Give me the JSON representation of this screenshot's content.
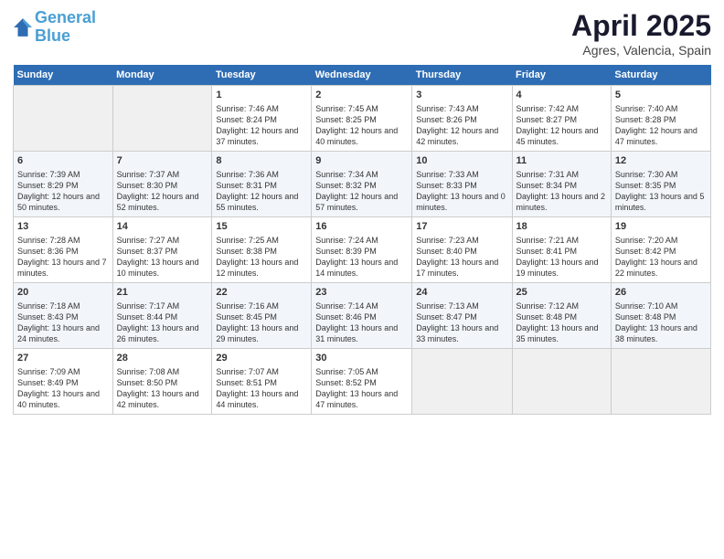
{
  "header": {
    "logo_line1": "General",
    "logo_line2": "Blue",
    "title": "April 2025",
    "subtitle": "Agres, Valencia, Spain"
  },
  "columns": [
    "Sunday",
    "Monday",
    "Tuesday",
    "Wednesday",
    "Thursday",
    "Friday",
    "Saturday"
  ],
  "weeks": [
    [
      {
        "day": "",
        "info": ""
      },
      {
        "day": "",
        "info": ""
      },
      {
        "day": "1",
        "info": "Sunrise: 7:46 AM\nSunset: 8:24 PM\nDaylight: 12 hours and 37 minutes."
      },
      {
        "day": "2",
        "info": "Sunrise: 7:45 AM\nSunset: 8:25 PM\nDaylight: 12 hours and 40 minutes."
      },
      {
        "day": "3",
        "info": "Sunrise: 7:43 AM\nSunset: 8:26 PM\nDaylight: 12 hours and 42 minutes."
      },
      {
        "day": "4",
        "info": "Sunrise: 7:42 AM\nSunset: 8:27 PM\nDaylight: 12 hours and 45 minutes."
      },
      {
        "day": "5",
        "info": "Sunrise: 7:40 AM\nSunset: 8:28 PM\nDaylight: 12 hours and 47 minutes."
      }
    ],
    [
      {
        "day": "6",
        "info": "Sunrise: 7:39 AM\nSunset: 8:29 PM\nDaylight: 12 hours and 50 minutes."
      },
      {
        "day": "7",
        "info": "Sunrise: 7:37 AM\nSunset: 8:30 PM\nDaylight: 12 hours and 52 minutes."
      },
      {
        "day": "8",
        "info": "Sunrise: 7:36 AM\nSunset: 8:31 PM\nDaylight: 12 hours and 55 minutes."
      },
      {
        "day": "9",
        "info": "Sunrise: 7:34 AM\nSunset: 8:32 PM\nDaylight: 12 hours and 57 minutes."
      },
      {
        "day": "10",
        "info": "Sunrise: 7:33 AM\nSunset: 8:33 PM\nDaylight: 13 hours and 0 minutes."
      },
      {
        "day": "11",
        "info": "Sunrise: 7:31 AM\nSunset: 8:34 PM\nDaylight: 13 hours and 2 minutes."
      },
      {
        "day": "12",
        "info": "Sunrise: 7:30 AM\nSunset: 8:35 PM\nDaylight: 13 hours and 5 minutes."
      }
    ],
    [
      {
        "day": "13",
        "info": "Sunrise: 7:28 AM\nSunset: 8:36 PM\nDaylight: 13 hours and 7 minutes."
      },
      {
        "day": "14",
        "info": "Sunrise: 7:27 AM\nSunset: 8:37 PM\nDaylight: 13 hours and 10 minutes."
      },
      {
        "day": "15",
        "info": "Sunrise: 7:25 AM\nSunset: 8:38 PM\nDaylight: 13 hours and 12 minutes."
      },
      {
        "day": "16",
        "info": "Sunrise: 7:24 AM\nSunset: 8:39 PM\nDaylight: 13 hours and 14 minutes."
      },
      {
        "day": "17",
        "info": "Sunrise: 7:23 AM\nSunset: 8:40 PM\nDaylight: 13 hours and 17 minutes."
      },
      {
        "day": "18",
        "info": "Sunrise: 7:21 AM\nSunset: 8:41 PM\nDaylight: 13 hours and 19 minutes."
      },
      {
        "day": "19",
        "info": "Sunrise: 7:20 AM\nSunset: 8:42 PM\nDaylight: 13 hours and 22 minutes."
      }
    ],
    [
      {
        "day": "20",
        "info": "Sunrise: 7:18 AM\nSunset: 8:43 PM\nDaylight: 13 hours and 24 minutes."
      },
      {
        "day": "21",
        "info": "Sunrise: 7:17 AM\nSunset: 8:44 PM\nDaylight: 13 hours and 26 minutes."
      },
      {
        "day": "22",
        "info": "Sunrise: 7:16 AM\nSunset: 8:45 PM\nDaylight: 13 hours and 29 minutes."
      },
      {
        "day": "23",
        "info": "Sunrise: 7:14 AM\nSunset: 8:46 PM\nDaylight: 13 hours and 31 minutes."
      },
      {
        "day": "24",
        "info": "Sunrise: 7:13 AM\nSunset: 8:47 PM\nDaylight: 13 hours and 33 minutes."
      },
      {
        "day": "25",
        "info": "Sunrise: 7:12 AM\nSunset: 8:48 PM\nDaylight: 13 hours and 35 minutes."
      },
      {
        "day": "26",
        "info": "Sunrise: 7:10 AM\nSunset: 8:48 PM\nDaylight: 13 hours and 38 minutes."
      }
    ],
    [
      {
        "day": "27",
        "info": "Sunrise: 7:09 AM\nSunset: 8:49 PM\nDaylight: 13 hours and 40 minutes."
      },
      {
        "day": "28",
        "info": "Sunrise: 7:08 AM\nSunset: 8:50 PM\nDaylight: 13 hours and 42 minutes."
      },
      {
        "day": "29",
        "info": "Sunrise: 7:07 AM\nSunset: 8:51 PM\nDaylight: 13 hours and 44 minutes."
      },
      {
        "day": "30",
        "info": "Sunrise: 7:05 AM\nSunset: 8:52 PM\nDaylight: 13 hours and 47 minutes."
      },
      {
        "day": "",
        "info": ""
      },
      {
        "day": "",
        "info": ""
      },
      {
        "day": "",
        "info": ""
      }
    ]
  ]
}
